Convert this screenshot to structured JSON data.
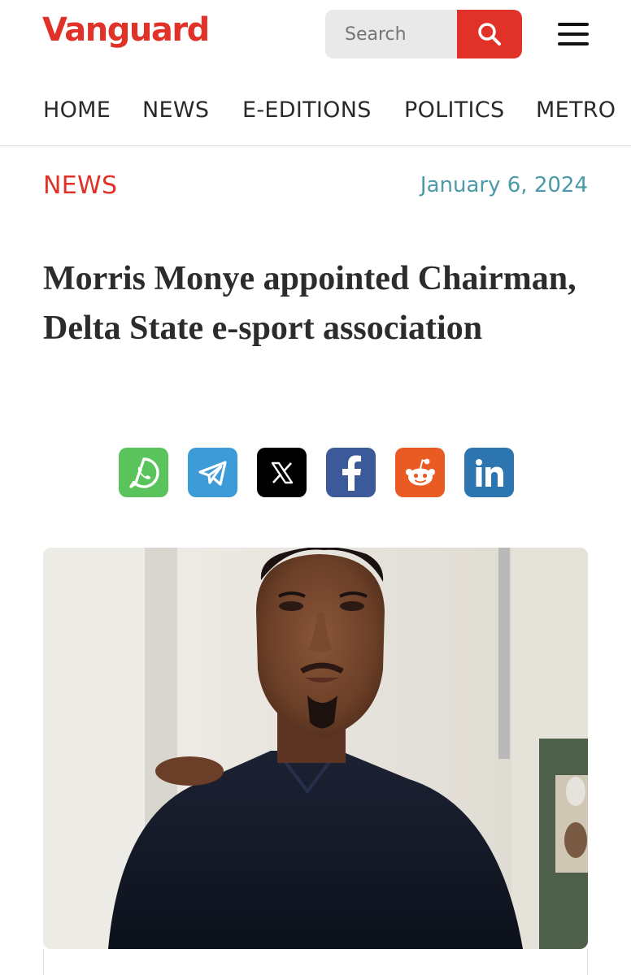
{
  "header": {
    "logo": "Vanguard",
    "search_placeholder": "Search",
    "search_icon": "search-icon",
    "menu_icon": "hamburger-menu-icon"
  },
  "nav": {
    "items": [
      "HOME",
      "NEWS",
      "E-EDITIONS",
      "POLITICS",
      "METRO"
    ]
  },
  "article": {
    "category": "NEWS",
    "date": "January 6, 2024",
    "headline": "Morris Monye appointed Chairman, Delta State e-sport association"
  },
  "share": [
    {
      "name": "whatsapp",
      "icon": "whatsapp-icon",
      "color": "#5ac35c"
    },
    {
      "name": "telegram",
      "icon": "telegram-icon",
      "color": "#3d9bd8"
    },
    {
      "name": "x",
      "icon": "x-icon",
      "color": "#000000"
    },
    {
      "name": "facebook",
      "icon": "facebook-icon",
      "color": "#3c5999"
    },
    {
      "name": "reddit",
      "icon": "reddit-icon",
      "color": "#ea5b23"
    },
    {
      "name": "linkedin",
      "icon": "linkedin-icon",
      "color": "#2c75b0"
    }
  ],
  "colors": {
    "brand": "#e1322a",
    "date": "#4a9aa8",
    "headline": "#2c2c2c"
  }
}
